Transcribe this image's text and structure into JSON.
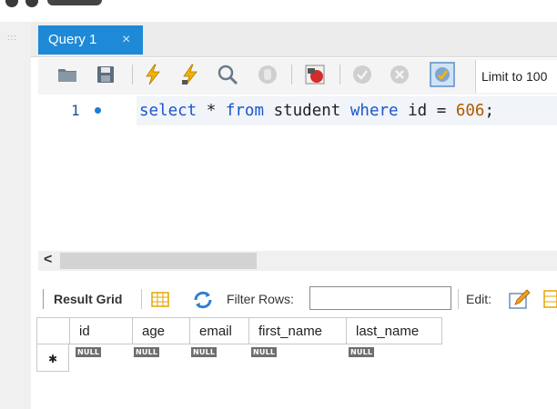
{
  "editor": {
    "tab_label": "Query 1",
    "tab_close": "×",
    "line_number": "1",
    "limit_label": "Limit to 100",
    "code": {
      "kw_select": "select",
      "star": "*",
      "kw_from": "from",
      "table": "student",
      "kw_where": "where",
      "column": "id",
      "op": "=",
      "value": "606",
      "terminator": ";"
    }
  },
  "result_toolbar": {
    "result_grid_label": "Result Grid",
    "filter_label": "Filter Rows:",
    "filter_value": "",
    "edit_label": "Edit:"
  },
  "grid": {
    "columns": [
      "id",
      "age",
      "email",
      "first_name",
      "last_name"
    ],
    "row_marker": "✱",
    "null_label": "NULL"
  },
  "colors": {
    "tab_active": "#1e89d6",
    "keyword": "#1c57c9",
    "number": "#b15a00"
  }
}
